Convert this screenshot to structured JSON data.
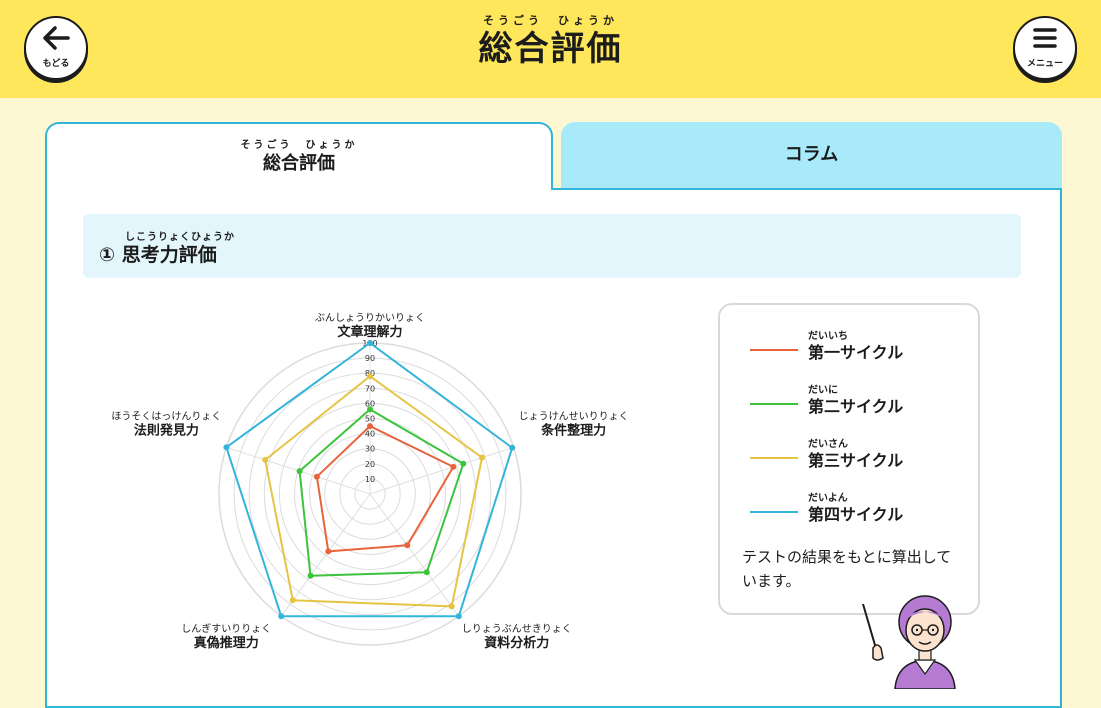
{
  "header": {
    "back_label": "もどる",
    "menu_label": "メニュー",
    "title_ruby": "そうごう　ひょうか",
    "title": "総合評価"
  },
  "tabs": [
    {
      "ruby": "そうごう　ひょうか",
      "label": "総合評価",
      "active": true
    },
    {
      "label": "コラム",
      "active": false
    }
  ],
  "section": {
    "number": "①",
    "ruby": "しこうりょくひょうか",
    "title": "思考力評価"
  },
  "chart_data": {
    "type": "radar",
    "axes": [
      {
        "label": "文章理解力",
        "ruby": "ぶんしょうりかいりょく"
      },
      {
        "label": "条件整理力",
        "ruby": "じょうけんせいりりょく"
      },
      {
        "label": "資料分析力",
        "ruby": "しりょうぶんせきりょく"
      },
      {
        "label": "真偽推理力",
        "ruby": "しんぎすいりりょく"
      },
      {
        "label": "法則発見力",
        "ruby": "ほうそくはっけんりょく"
      }
    ],
    "ticks": [
      "10",
      "20",
      "30",
      "40",
      "50",
      "60",
      "70",
      "80",
      "90",
      "100"
    ],
    "range": [
      0,
      100
    ],
    "series": [
      {
        "name": "第一サイクル",
        "ruby": "だいいち",
        "color": "#E8643C",
        "values": [
          45,
          58,
          42,
          47,
          37
        ]
      },
      {
        "name": "第二サイクル",
        "ruby": "だいに",
        "color": "#3BC43B",
        "values": [
          56,
          65,
          64,
          67,
          49
        ]
      },
      {
        "name": "第三サイクル",
        "ruby": "だいさん",
        "color": "#E6C443",
        "values": [
          78,
          78,
          92,
          87,
          73
        ]
      },
      {
        "name": "第四サイクル",
        "ruby": "だいよん",
        "color": "#33B5DA",
        "values": [
          100,
          99,
          100,
          100,
          100
        ]
      }
    ]
  },
  "legend_note": "テストの結果をもとに算出しています。"
}
